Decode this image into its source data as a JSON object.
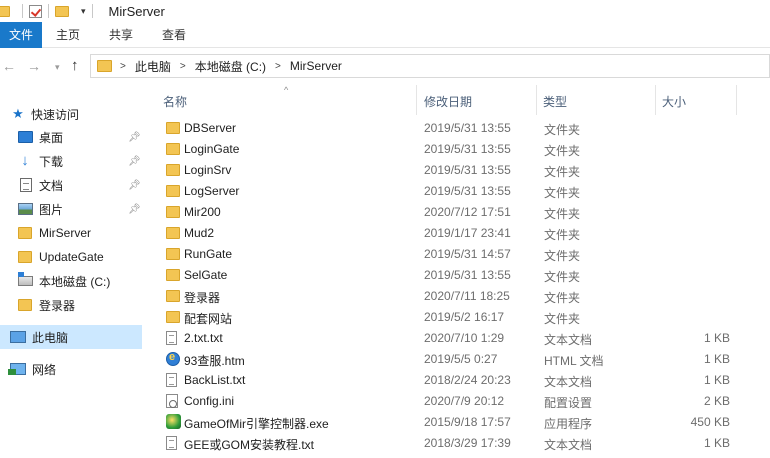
{
  "window": {
    "title": "MirServer"
  },
  "ribbon": {
    "tabs": [
      "文件",
      "主页",
      "共享",
      "查看"
    ]
  },
  "address": {
    "crumbs": [
      "此电脑",
      "本地磁盘 (C:)",
      "MirServer"
    ]
  },
  "sidebar": {
    "items": [
      {
        "label": "快速访问",
        "icon": "star-icon"
      },
      {
        "label": "桌面",
        "icon": "desktop-icon",
        "pinned": true
      },
      {
        "label": "下载",
        "icon": "download-icon",
        "pinned": true
      },
      {
        "label": "文档",
        "icon": "document-icon",
        "pinned": true
      },
      {
        "label": "图片",
        "icon": "pictures-icon",
        "pinned": true
      },
      {
        "label": "MirServer",
        "icon": "folder-icon"
      },
      {
        "label": "UpdateGate",
        "icon": "folder-icon"
      },
      {
        "label": "本地磁盘 (C:)",
        "icon": "drive-icon"
      },
      {
        "label": "登录器",
        "icon": "folder-icon"
      },
      {
        "label": "此电脑",
        "icon": "this-pc-icon",
        "selected": true
      },
      {
        "label": "网络",
        "icon": "network-icon"
      }
    ]
  },
  "columns": {
    "name": "名称",
    "date": "修改日期",
    "type": "类型",
    "size": "大小"
  },
  "files": [
    {
      "name": "DBServer",
      "date": "2019/5/31 13:55",
      "type": "文件夹",
      "size": "",
      "icon": "folder-icon"
    },
    {
      "name": "LoginGate",
      "date": "2019/5/31 13:55",
      "type": "文件夹",
      "size": "",
      "icon": "folder-icon"
    },
    {
      "name": "LoginSrv",
      "date": "2019/5/31 13:55",
      "type": "文件夹",
      "size": "",
      "icon": "folder-icon"
    },
    {
      "name": "LogServer",
      "date": "2019/5/31 13:55",
      "type": "文件夹",
      "size": "",
      "icon": "folder-icon"
    },
    {
      "name": "Mir200",
      "date": "2020/7/12 17:51",
      "type": "文件夹",
      "size": "",
      "icon": "folder-icon"
    },
    {
      "name": "Mud2",
      "date": "2019/1/17 23:41",
      "type": "文件夹",
      "size": "",
      "icon": "folder-icon"
    },
    {
      "name": "RunGate",
      "date": "2019/5/31 14:57",
      "type": "文件夹",
      "size": "",
      "icon": "folder-icon"
    },
    {
      "name": "SelGate",
      "date": "2019/5/31 13:55",
      "type": "文件夹",
      "size": "",
      "icon": "folder-icon"
    },
    {
      "name": "登录器",
      "date": "2020/7/11 18:25",
      "type": "文件夹",
      "size": "",
      "icon": "folder-icon"
    },
    {
      "name": "配套网站",
      "date": "2019/5/2 16:17",
      "type": "文件夹",
      "size": "",
      "icon": "folder-icon"
    },
    {
      "name": "2.txt.txt",
      "date": "2020/7/10 1:29",
      "type": "文本文档",
      "size": "1 KB",
      "icon": "text-file-icon"
    },
    {
      "name": "93查服.htm",
      "date": "2019/5/5 0:27",
      "type": "HTML 文档",
      "size": "1 KB",
      "icon": "html-file-icon"
    },
    {
      "name": "BackList.txt",
      "date": "2018/2/24 20:23",
      "type": "文本文档",
      "size": "1 KB",
      "icon": "text-file-icon"
    },
    {
      "name": "Config.ini",
      "date": "2020/7/9 20:12",
      "type": "配置设置",
      "size": "2 KB",
      "icon": "config-file-icon"
    },
    {
      "name": "GameOfMir引擎控制器.exe",
      "date": "2015/9/18 17:57",
      "type": "应用程序",
      "size": "450 KB",
      "icon": "exe-file-icon"
    },
    {
      "name": "GEE或GOM安装教程.txt",
      "date": "2018/3/29 17:39",
      "type": "文本文档",
      "size": "1 KB",
      "icon": "text-file-icon"
    }
  ]
}
